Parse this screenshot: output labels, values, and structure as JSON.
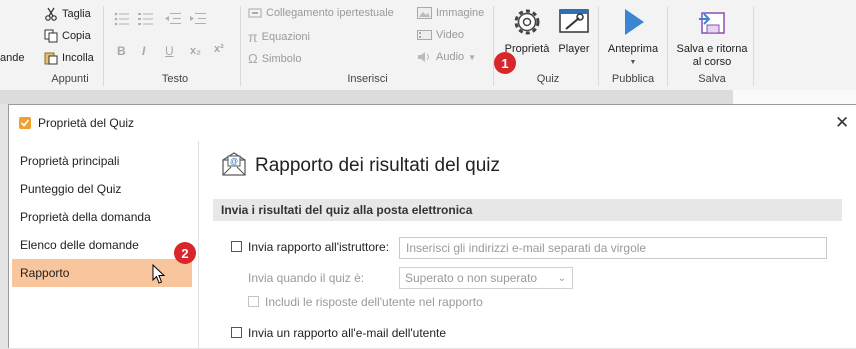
{
  "ribbon": {
    "clip_label": "ande",
    "cut": "Taglia",
    "copy": "Copia",
    "paste": "Incolla",
    "groups": {
      "clipboard": "Appunti",
      "text": "Testo",
      "insert": "Inserisci",
      "quiz": "Quiz",
      "publish": "Pubblica",
      "save": "Salva"
    },
    "format": {
      "bold": "B",
      "italic": "I",
      "underline": "U",
      "subscript": "x₂",
      "superscript": "x²"
    },
    "insert": {
      "hyperlink": "Collegamento ipertestuale",
      "equations": "Equazioni",
      "symbol": "Simbolo",
      "image": "Immagine",
      "video": "Video",
      "audio": "Audio"
    },
    "quiz": {
      "properties": "Proprietà",
      "player": "Player"
    },
    "publish": {
      "preview": "Anteprima"
    },
    "save": {
      "line1": "Salva e ritorna",
      "line2": "al corso"
    },
    "badge1": "1"
  },
  "dialog": {
    "title": "Proprietà del Quiz",
    "close": "✕",
    "sidebar": [
      {
        "label": "Proprietà principali"
      },
      {
        "label": "Punteggio del Quiz"
      },
      {
        "label": "Proprietà della domanda"
      },
      {
        "label": "Elenco delle domande"
      },
      {
        "label": "Rapporto"
      }
    ],
    "badge2": "2",
    "content": {
      "title": "Rapporto dei risultati del quiz",
      "section": "Invia i risultati del quiz alla posta elettronica",
      "send_instructor_label": "Invia rapporto all'istruttore:",
      "email_placeholder": "Inserisci gli indirizzi e-mail separati da virgole",
      "send_when_label": "Invia quando il quiz è:",
      "send_when_value": "Superato o non superato",
      "include_answers_label": "Includi le risposte dell'utente nel rapporto",
      "send_user_label": "Invia un rapporto all'e-mail dell'utente"
    }
  }
}
